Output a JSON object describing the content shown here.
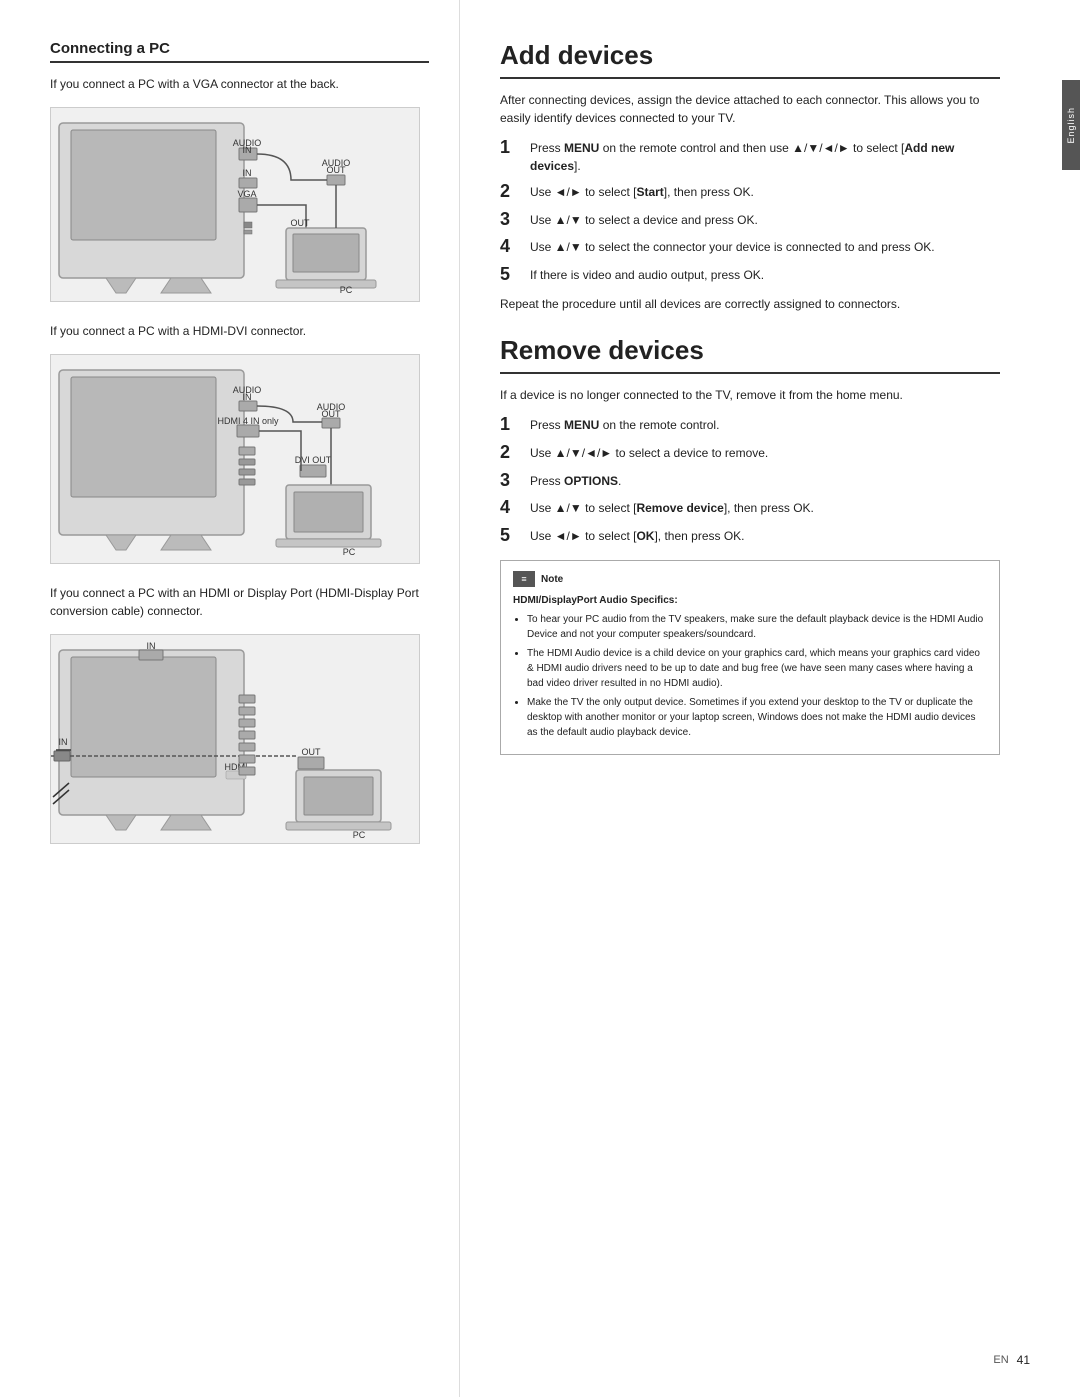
{
  "page": {
    "page_number": "41",
    "language_tab": "English"
  },
  "left_section": {
    "title": "Connecting a PC",
    "diagrams": [
      {
        "id": "vga-diagram",
        "intro_text": "If you connect a PC with a VGA connector at the back.",
        "labels": [
          "AUDIO IN",
          "IN",
          "AUDIO OUT",
          "VGA",
          "OUT",
          "PC"
        ]
      },
      {
        "id": "hdmi-dvi-diagram",
        "intro_text": "If you connect a PC with a HDMI-DVI connector.",
        "labels": [
          "AUDIO IN",
          "HDMI 4 IN only",
          "AUDIO OUT",
          "DVI OUT",
          "PC"
        ]
      },
      {
        "id": "hdmi-display-diagram",
        "intro_text": "If you connect a PC with an HDMI or Display Port (HDMI-Display Port conversion cable) connector.",
        "labels": [
          "IN",
          "OUT",
          "HDMI",
          "PC"
        ]
      }
    ]
  },
  "right_section": {
    "add_devices": {
      "title": "Add devices",
      "intro": "After connecting devices, assign the device attached to each connector. This allows you to easily identify devices connected to your TV.",
      "steps": [
        {
          "num": "1",
          "text": "Press MENU on the remote control and then use ▲/▼/◄/► to select [Add new devices]."
        },
        {
          "num": "2",
          "text": "Use ◄/► to select [Start], then press OK."
        },
        {
          "num": "3",
          "text": "Use ▲/▼ to select a device and press OK."
        },
        {
          "num": "4",
          "text": "Use ▲/▼ to select the connector your device is connected to and press OK."
        },
        {
          "num": "5",
          "text": "If there is video and audio output, press OK."
        }
      ],
      "footer_text": "Repeat the procedure until all devices are correctly assigned to connectors."
    },
    "remove_devices": {
      "title": "Remove devices",
      "intro": "If a device is no longer connected to the TV, remove it from the home menu.",
      "steps": [
        {
          "num": "1",
          "text": "Press MENU on the remote control."
        },
        {
          "num": "2",
          "text": "Use ▲/▼/◄/► to select a device to remove."
        },
        {
          "num": "3",
          "text": "Press OPTIONS."
        },
        {
          "num": "4",
          "text": "Use ▲/▼ to select [Remove device], then press OK."
        },
        {
          "num": "5",
          "text": "Use ◄/► to select [OK], then press OK."
        }
      ]
    },
    "note": {
      "header": "Note",
      "subtitle": "HDMI/DisplayPort Audio Specifics:",
      "bullets": [
        "To hear your PC audio from the TV speakers, make sure the default playback device is the HDMI Audio Device and not your computer speakers/soundcard.",
        "The HDMI Audio device is a child device on your graphics card, which means your graphics card video & HDMI audio drivers need to be up to date and bug free (we have seen many cases where having a bad video driver resulted in no HDMI audio).",
        "Make the TV the only output device. Sometimes if you extend your desktop to the TV or duplicate the desktop with another monitor or your laptop screen, Windows does not make the HDMI audio devices as the default audio playback device."
      ]
    }
  }
}
